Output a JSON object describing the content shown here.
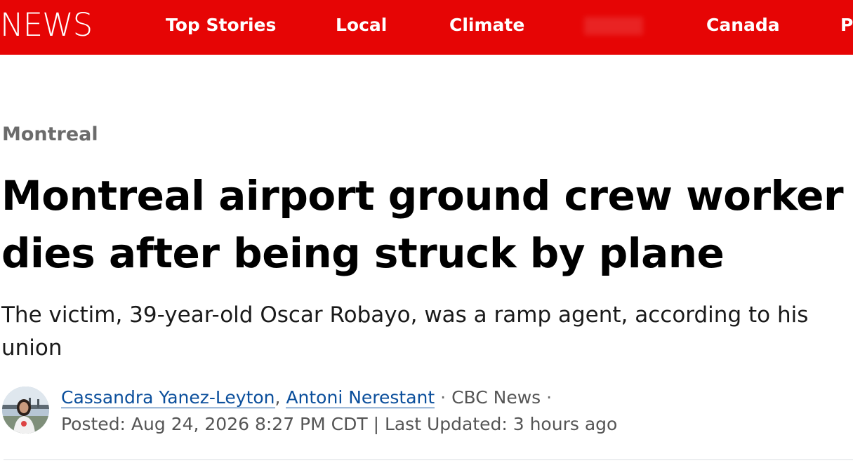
{
  "header": {
    "logo_text": "NEWS",
    "background_color": "#e60505",
    "nav": [
      {
        "label": "Top Stories"
      },
      {
        "label": "Local"
      },
      {
        "label": "Climate"
      },
      {
        "label": ""
      },
      {
        "label": "Canada"
      },
      {
        "label": "P"
      }
    ]
  },
  "article": {
    "section": "Montreal",
    "headline": "Montreal airport ground crew worker dies after being struck by plane",
    "deck": "The victim, 39-year-old Oscar Robayo, was a ramp agent, according to his union",
    "byline": {
      "authors": [
        "Cassandra Yanez-Leyton",
        "Antoni Nerestant"
      ],
      "comma": ",",
      "separator": "·",
      "outlet": "CBC News",
      "posted": "Posted: Aug 24, 2026 8:27 PM CDT | Last Updated: 3 hours ago"
    }
  },
  "colors": {
    "brand_red": "#e60505",
    "author_link": "#0b4f9c",
    "section_gray": "#6b6b6b"
  }
}
